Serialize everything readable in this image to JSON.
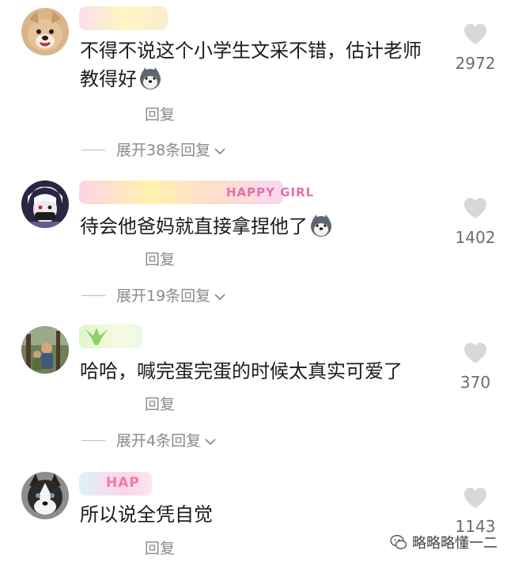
{
  "comments": [
    {
      "text_line1": "不得不说这个小学生文采不错，估计老师",
      "text_line2": "教得好",
      "reply_label": "回复",
      "expand_label": "展开38条回复",
      "likes": "2972"
    },
    {
      "text_line1": "待会他爸妈就直接拿捏他了",
      "name_tag": "HAPPY GIRL",
      "reply_label": "回复",
      "expand_label": "展开19条回复",
      "likes": "1402"
    },
    {
      "text_line1": "哈哈，喊完蛋完蛋的时候太真实可爱了",
      "reply_label": "回复",
      "expand_label": "展开4条回复",
      "likes": "370"
    },
    {
      "text_line1": "所以说全凭自觉",
      "name_tag": "HAP",
      "reply_label": "回复",
      "likes": "1143"
    }
  ],
  "watermark": {
    "text": "略略略懂一二"
  },
  "colors": {
    "secondary_text": "#8a8a8a",
    "heart": "#d8d8d8",
    "count": "#6d6d6d"
  },
  "icons": {
    "like": "heart-icon",
    "expand": "chevron-down-icon",
    "sticker": "husky-sticker-icon"
  }
}
